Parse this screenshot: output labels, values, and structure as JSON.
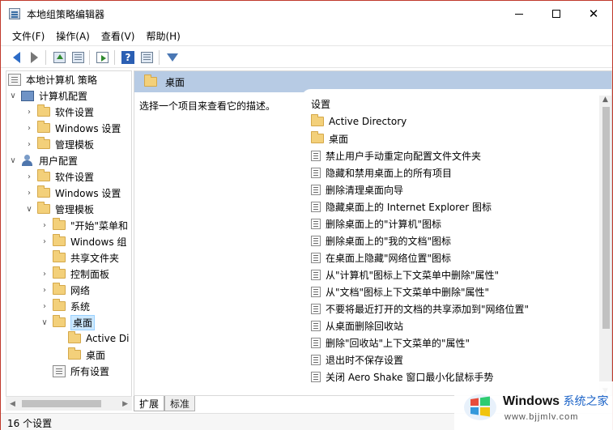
{
  "window": {
    "title": "本地组策略编辑器",
    "minimize": "—",
    "close": "✕"
  },
  "menu": [
    "文件(F)",
    "操作(A)",
    "查看(V)",
    "帮助(H)"
  ],
  "toolbar": {
    "help_label": "?"
  },
  "tree": [
    {
      "label": "本地计算机 策略",
      "level": 0,
      "expander": "",
      "icon": "policy-root-icon"
    },
    {
      "label": "计算机配置",
      "level": 1,
      "expander": "∨",
      "icon": "computer-icon"
    },
    {
      "label": "软件设置",
      "level": 2,
      "expander": "›",
      "icon": "folder-icon"
    },
    {
      "label": "Windows 设置",
      "level": 2,
      "expander": "›",
      "icon": "folder-icon"
    },
    {
      "label": "管理模板",
      "level": 2,
      "expander": "›",
      "icon": "folder-icon"
    },
    {
      "label": "用户配置",
      "level": 1,
      "expander": "∨",
      "icon": "user-icon"
    },
    {
      "label": "软件设置",
      "level": 2,
      "expander": "›",
      "icon": "folder-icon"
    },
    {
      "label": "Windows 设置",
      "level": 2,
      "expander": "›",
      "icon": "folder-icon"
    },
    {
      "label": "管理模板",
      "level": 2,
      "expander": "∨",
      "icon": "folder-icon"
    },
    {
      "label": "\"开始\"菜单和",
      "level": 3,
      "expander": "›",
      "icon": "folder-icon"
    },
    {
      "label": "Windows 组",
      "level": 3,
      "expander": "›",
      "icon": "folder-icon"
    },
    {
      "label": "共享文件夹",
      "level": 3,
      "expander": "",
      "icon": "folder-icon"
    },
    {
      "label": "控制面板",
      "level": 3,
      "expander": "›",
      "icon": "folder-icon"
    },
    {
      "label": "网络",
      "level": 3,
      "expander": "›",
      "icon": "folder-icon"
    },
    {
      "label": "系统",
      "level": 3,
      "expander": "›",
      "icon": "folder-icon"
    },
    {
      "label": "桌面",
      "level": 3,
      "expander": "∨",
      "icon": "folder-icon",
      "selected": true
    },
    {
      "label": "Active Di",
      "level": 4,
      "expander": "",
      "icon": "folder-icon"
    },
    {
      "label": "桌面",
      "level": 4,
      "expander": "",
      "icon": "folder-icon"
    },
    {
      "label": "所有设置",
      "level": 3,
      "expander": "",
      "icon": "all-settings-icon"
    }
  ],
  "right": {
    "header": "桌面",
    "description": "选择一个项目来查看它的描述。",
    "column_header": "设置",
    "items": [
      {
        "label": "Active Directory",
        "type": "folder"
      },
      {
        "label": "桌面",
        "type": "folder"
      },
      {
        "label": "禁止用户手动重定向配置文件文件夹",
        "type": "policy"
      },
      {
        "label": "隐藏和禁用桌面上的所有项目",
        "type": "policy"
      },
      {
        "label": "删除清理桌面向导",
        "type": "policy"
      },
      {
        "label": "隐藏桌面上的 Internet Explorer 图标",
        "type": "policy"
      },
      {
        "label": "删除桌面上的\"计算机\"图标",
        "type": "policy"
      },
      {
        "label": "删除桌面上的\"我的文档\"图标",
        "type": "policy"
      },
      {
        "label": "在桌面上隐藏\"网络位置\"图标",
        "type": "policy"
      },
      {
        "label": "从\"计算机\"图标上下文菜单中删除\"属性\"",
        "type": "policy"
      },
      {
        "label": "从\"文档\"图标上下文菜单中删除\"属性\"",
        "type": "policy"
      },
      {
        "label": "不要将最近打开的文档的共享添加到\"网络位置\"",
        "type": "policy"
      },
      {
        "label": "从桌面删除回收站",
        "type": "policy"
      },
      {
        "label": "删除\"回收站\"上下文菜单的\"属性\"",
        "type": "policy"
      },
      {
        "label": "退出时不保存设置",
        "type": "policy"
      },
      {
        "label": "关闭 Aero Shake 窗口最小化鼠标手势",
        "type": "policy"
      }
    ]
  },
  "tabs": [
    "扩展",
    "标准"
  ],
  "status": "16 个设置",
  "watermark": {
    "brand": "Windows",
    "brand_cn": "系统之家",
    "url": "www.bjjmlv.com"
  },
  "colors": {
    "header_bg": "#b7cbe4",
    "selected_bg": "#cce8ff",
    "accent": "#2d6cc7"
  }
}
